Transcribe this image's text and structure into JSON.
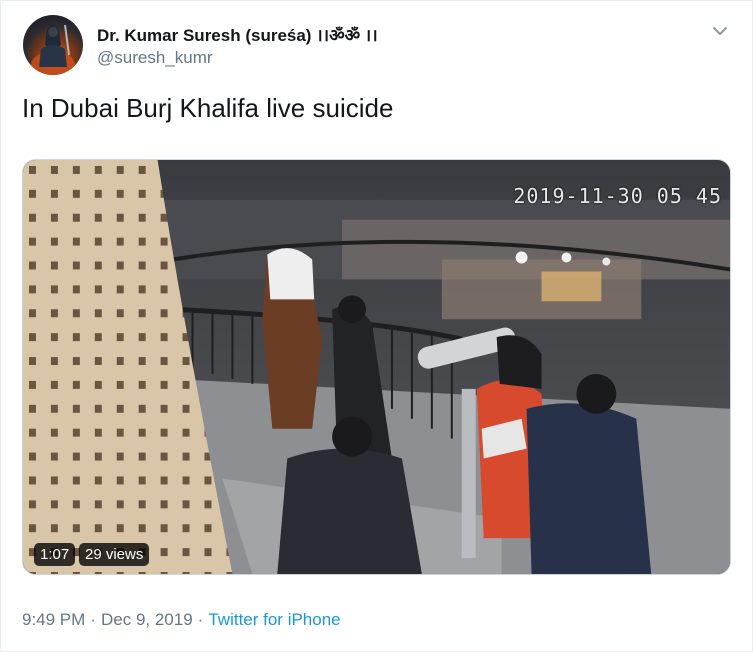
{
  "author": {
    "display_name": "Dr. Kumar Suresh (sureśa) ।।ॐॐ ।।",
    "handle": "@suresh_kumr"
  },
  "tweet": {
    "text": "In Dubai Burj Khalifa live suicide"
  },
  "media": {
    "camera_timestamp": "2019-11-30 05 45",
    "duration": "1:07",
    "views": "29 views"
  },
  "footer": {
    "time": "9:49 PM",
    "separator": "·",
    "date": "Dec 9, 2019",
    "source": "Twitter for iPhone"
  },
  "icons": {
    "menu": "chevron-down-icon"
  },
  "colors": {
    "text_primary": "#14171a",
    "text_secondary": "#657786",
    "link": "#1b95e0"
  }
}
